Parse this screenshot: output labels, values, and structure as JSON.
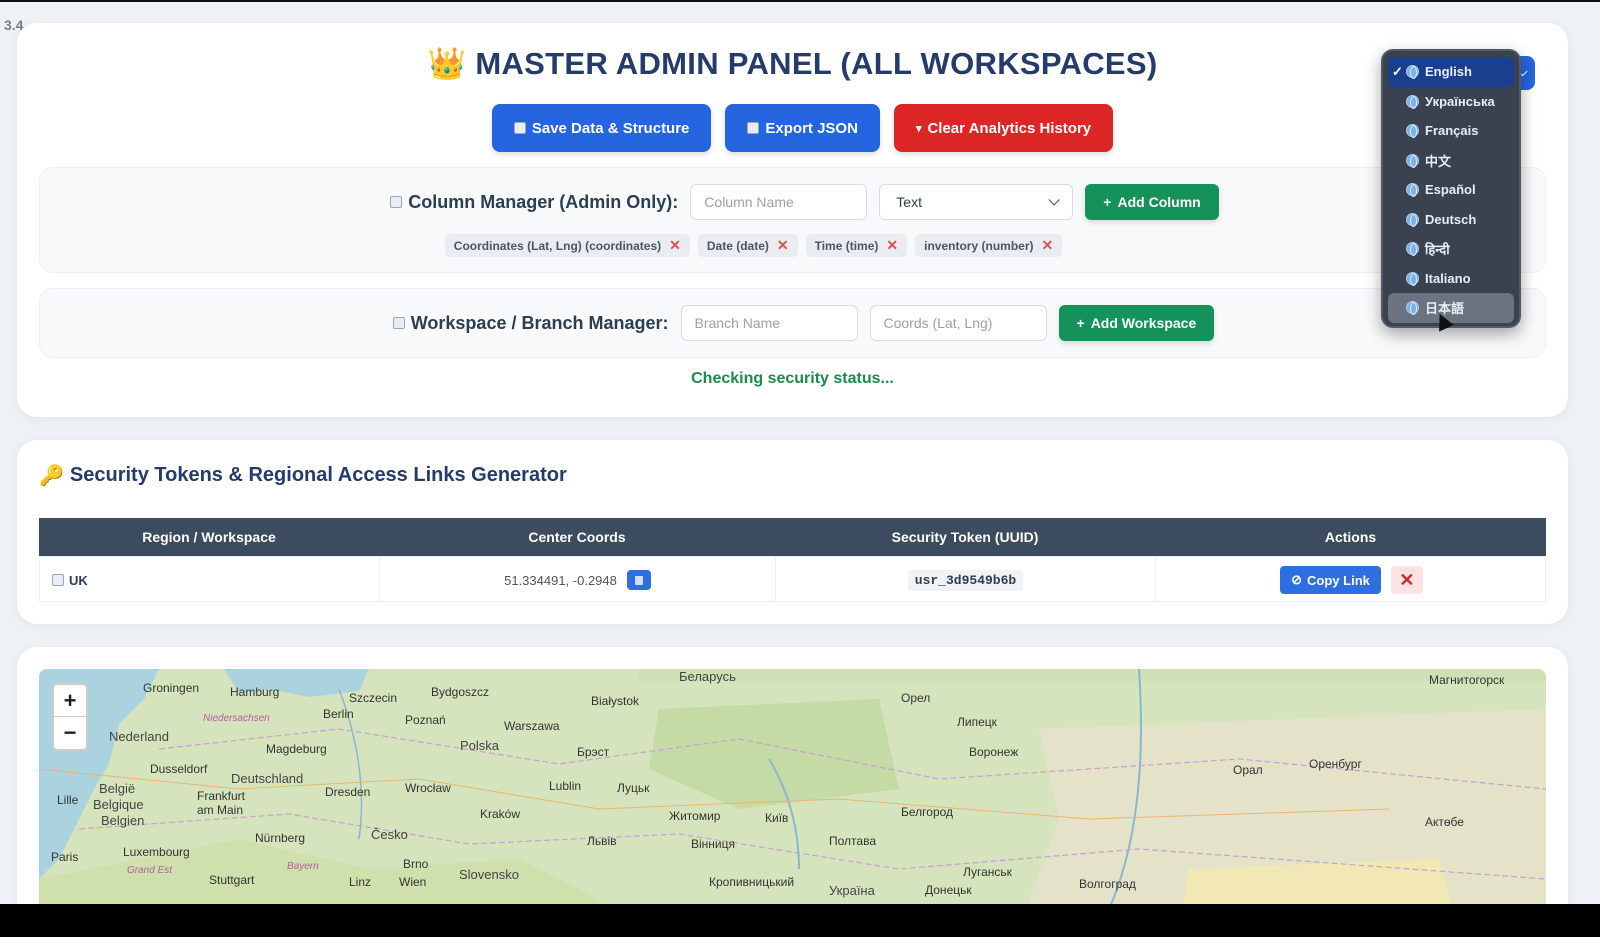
{
  "version": "3.4",
  "header": {
    "title": "MASTER ADMIN PANEL (ALL WORKSPACES)",
    "crown_icon": "👑",
    "buttons": {
      "save": "Save Data & Structure",
      "export": "Export JSON",
      "clear": "Clear Analytics History"
    }
  },
  "column_manager": {
    "label": "Column Manager (Admin Only):",
    "name_placeholder": "Column Name",
    "type_selected": "Text",
    "add_button": "Add Column",
    "columns": [
      "Coordinates (Lat, Lng) (coordinates)",
      "Date (date)",
      "Time (time)",
      "inventory (number)"
    ],
    "remove_symbol": "✕"
  },
  "workspace_manager": {
    "label": "Workspace / Branch Manager:",
    "branch_placeholder": "Branch Name",
    "coords_placeholder": "Coords (Lat, Lng)",
    "add_button": "Add Workspace"
  },
  "status_text": "Checking security status...",
  "language_menu": {
    "options": [
      "English",
      "Українська",
      "Français",
      "中文",
      "Español",
      "Deutsch",
      "हिन्दी",
      "Italiano",
      "日本語"
    ],
    "selected": "English",
    "hovered": "日本語",
    "check_mark": "✓"
  },
  "security": {
    "title": "Security Tokens & Regional Access Links Generator",
    "key_icon": "🔑",
    "columns": [
      "Region / Workspace",
      "Center Coords",
      "Security Token (UUID)",
      "Actions"
    ],
    "rows": [
      {
        "region": "UK",
        "coords": "51.334491, -0.2948",
        "token": "usr_3d9549b6b",
        "copy_label": "Copy Link",
        "delete_symbol": "✕"
      }
    ]
  },
  "map": {
    "zoom_in": "+",
    "zoom_out": "−",
    "labels": [
      "Groningen",
      "Hamburg",
      "Szczecin",
      "Bydgoszcz",
      "Белaрусь",
      "Орел",
      "Магнитогорск",
      "Nederland",
      "Berlin",
      "Poznań",
      "Warszawa",
      "Białystok",
      "Липецк",
      "Воронеж",
      "Magdeburg",
      "Polska",
      "Брэст",
      "Оренбург",
      "Dusseldorf",
      "Deutschland",
      "Lublin",
      "Луцьк",
      "Житомир",
      "Київ",
      "Белгород",
      "Орал",
      "België",
      "Belgique",
      "Belgien",
      "Frankfurt am Main",
      "Dresden",
      "Wrocław",
      "Kraków",
      "Львів",
      "Вінниця",
      "Полтава",
      "Актөбе",
      "Lille",
      "Luxembourg",
      "Nürnberg",
      "Česko",
      "Paris",
      "Brno",
      "Slovensko",
      "Stuttgart",
      "Linz",
      "Wien",
      "Кропивницький",
      "Україна",
      "Донецьк",
      "Луганськ",
      "Волгоград",
      "Niedersachsen",
      "Bayern",
      "Grand Est"
    ]
  }
}
